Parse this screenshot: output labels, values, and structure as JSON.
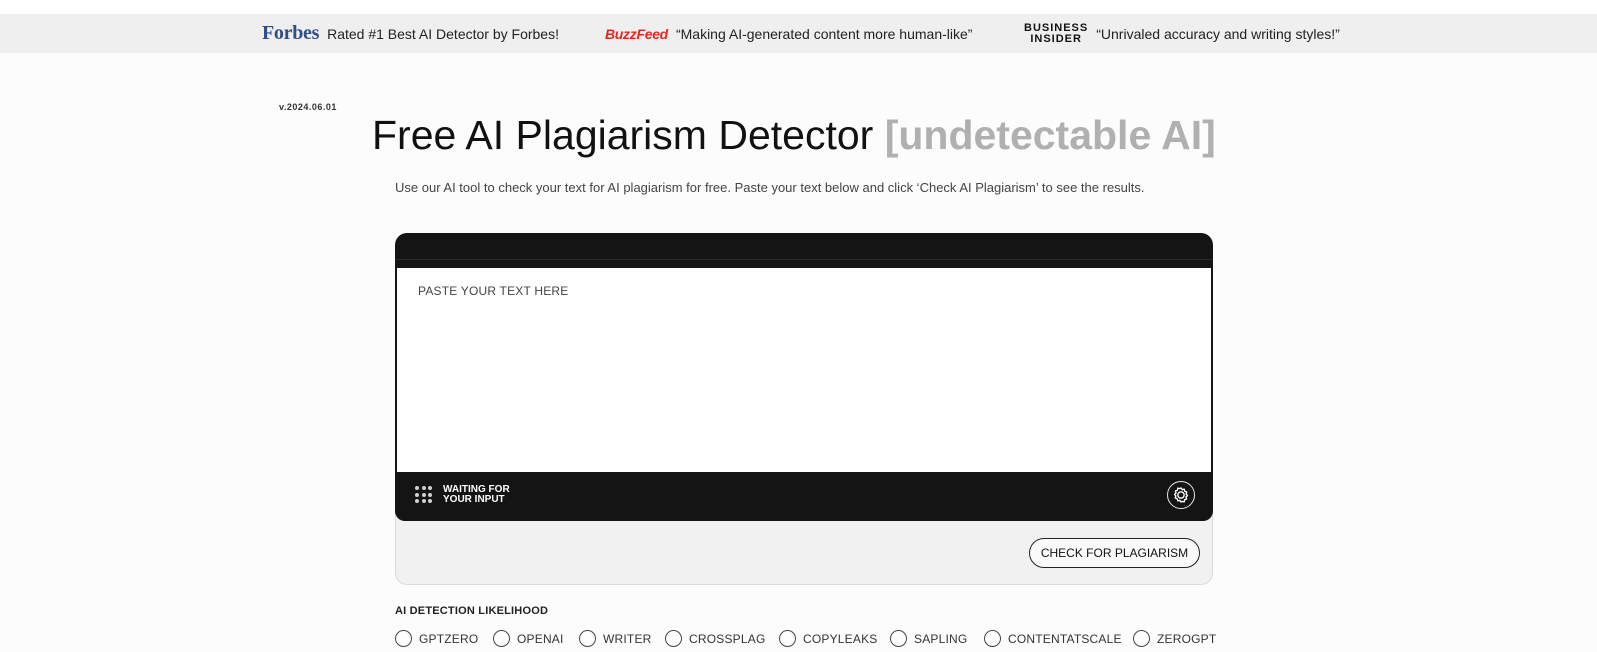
{
  "press": [
    {
      "logo": "Forbes",
      "quote": "Rated #1 Best AI Detector by Forbes!"
    },
    {
      "logo": "BuzzFeed",
      "quote": "“Making AI-generated content more human-like”"
    },
    {
      "logo_line1": "BUSINESS",
      "logo_line2": "INSIDER",
      "quote": "“Unrivaled accuracy and writing styles!”"
    }
  ],
  "version": "v.2024.06.01",
  "title": {
    "main": "Free AI Plagiarism Detector",
    "accent": "[undetectable AI]"
  },
  "subtitle": "Use our AI tool to check your text for AI plagiarism for free. Paste your text below and click ‘Check AI Plagiarism’ to see the results.",
  "editor": {
    "placeholder": "PASTE YOUR TEXT HERE",
    "status_line1": "WAITING FOR",
    "status_line2": "YOUR INPUT",
    "check_button": "CHECK FOR PLAGIARISM"
  },
  "likelihood": {
    "label": "AI DETECTION LIKELIHOOD",
    "detectors": [
      "GPTZERO",
      "OPENAI",
      "WRITER",
      "CROSSPLAG",
      "COPYLEAKS",
      "SAPLING",
      "CONTENTATSCALE",
      "ZEROGPT"
    ]
  },
  "colors": {
    "forbes": "#2f4f8a",
    "buzzfeed": "#e32a1f",
    "accent_gray": "#b0b0b0",
    "editor_dark": "#141414"
  }
}
